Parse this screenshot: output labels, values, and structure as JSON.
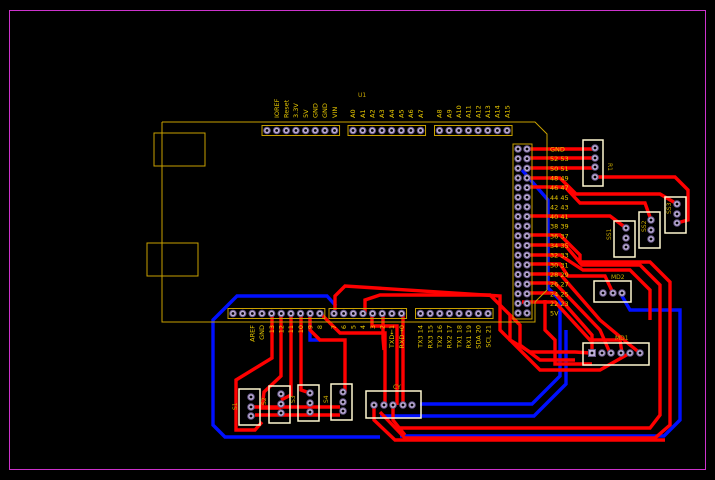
{
  "board": {
    "ref": "U1",
    "outline_color": "#cc33cc",
    "trace_top": "#ff0000",
    "trace_bottom": "#0010ff",
    "silk": "#e8c800"
  },
  "headers": {
    "power": [
      "IOREF",
      "Reset",
      "3.3V",
      "5V",
      "GND",
      "GND",
      "VIN"
    ],
    "analog_low": [
      "A0",
      "A1",
      "A2",
      "A3",
      "A4",
      "A5",
      "A6",
      "A7"
    ],
    "analog_high": [
      "A8",
      "A9",
      "A10",
      "A11",
      "A12",
      "A13",
      "A14",
      "A15"
    ],
    "pwm": [
      "AREF",
      "GND",
      "13",
      "12",
      "11",
      "10",
      "9",
      "8"
    ],
    "digital_low": [
      "7",
      "6",
      "5",
      "4",
      "3",
      "2",
      "TXD←1",
      "RXD→0"
    ],
    "comm": [
      "TX3  14",
      "RX3  15",
      "TX2  16",
      "RX2  17",
      "TX1  18",
      "RX1  19",
      "SDA  20",
      "SCL  21"
    ],
    "double": [
      "GND",
      "52 53",
      "50 51",
      "48 49",
      "46 47",
      "44 45",
      "42 43",
      "40 41",
      "38 39",
      "36 37",
      "34 35",
      "32 33",
      "30 31",
      "28 29",
      "26 27",
      "24 25",
      "22 23",
      "5V"
    ]
  },
  "components": {
    "r1": "R1",
    "ss1": "SS1",
    "ss2": "SS2",
    "ss3": "SS3",
    "md1": "MD1",
    "md2": "MD2",
    "cy": "CY",
    "s1": "S1",
    "s2": "S2",
    "s3": "S3",
    "s4": "S4"
  }
}
